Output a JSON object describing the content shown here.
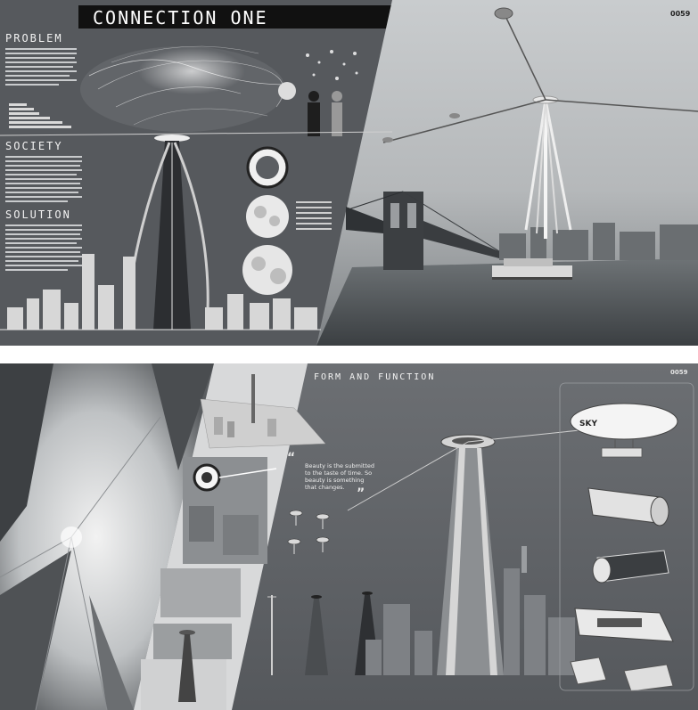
{
  "board1": {
    "title": "CONNECTION ONE",
    "page_number": "0059",
    "sections": [
      {
        "heading": "PROBLEM"
      },
      {
        "heading": "SOCIETY"
      },
      {
        "heading": "SOLUTION"
      }
    ]
  },
  "board2": {
    "page_number": "0059",
    "section_title": "FORM AND FUNCTION",
    "quote": {
      "lines": [
        "Beauty is the submitted",
        "to the taste of time. So",
        "beauty is something",
        "that changes."
      ]
    },
    "airship_label": "SKY"
  },
  "colors": {
    "board_dark": "#5b5e62",
    "board_mid": "#6a6d71",
    "title_bar": "#111111",
    "title_text": "#ffffff",
    "accent_white": "#f2f2f2"
  }
}
